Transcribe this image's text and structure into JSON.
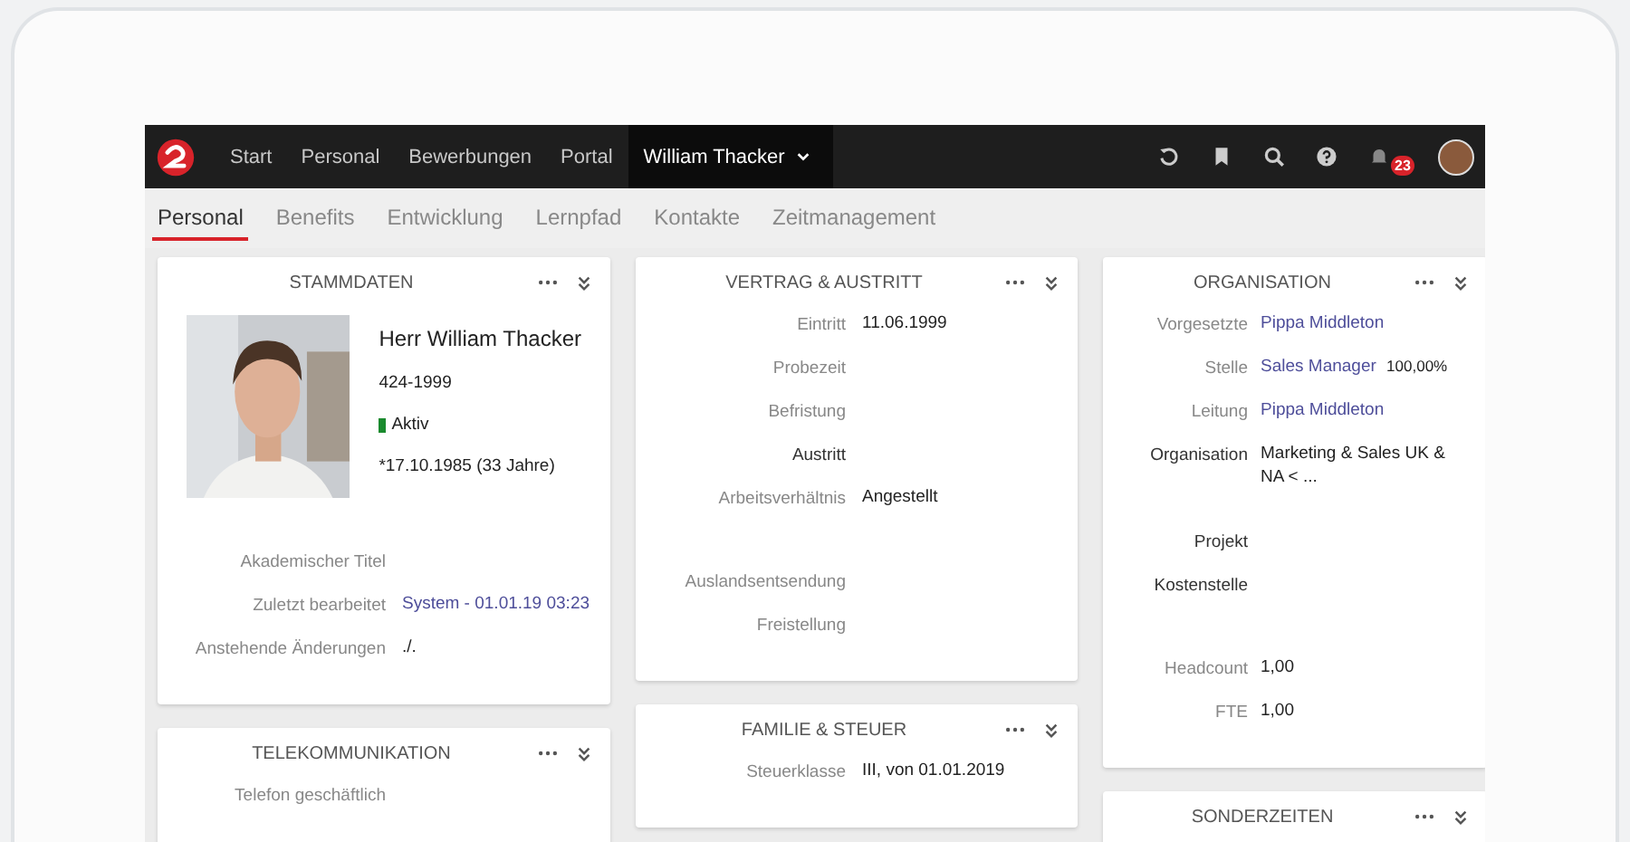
{
  "nav": {
    "items": [
      {
        "label": "Start",
        "selected": false
      },
      {
        "label": "Personal",
        "selected": false
      },
      {
        "label": "Bewerbungen",
        "selected": false
      },
      {
        "label": "Portal",
        "selected": false
      },
      {
        "label": "William Thacker",
        "selected": true
      }
    ],
    "notification_count": "23"
  },
  "tabs": [
    {
      "label": "Personal",
      "selected": true
    },
    {
      "label": "Benefits",
      "selected": false
    },
    {
      "label": "Entwicklung",
      "selected": false
    },
    {
      "label": "Lernpfad",
      "selected": false
    },
    {
      "label": "Kontakte",
      "selected": false
    },
    {
      "label": "Zeitmanagement",
      "selected": false
    }
  ],
  "columns": [
    {
      "cards": [
        {
          "title": "STAMMDATEN",
          "profile": {
            "kind": "picture",
            "name": "Herr William Thacker",
            "number": "424-1999",
            "status": "Aktiv",
            "birth": "*17.10.1985 (33 Jahre)"
          },
          "sections": [
            [
              {
                "label": "Akademischer Titel",
                "highlighted": false
              },
              {
                "label": "Zuletzt bearbeitet",
                "value": "System - 01.01.19 03:23",
                "link": true,
                "highlighted": false
              },
              {
                "label": "Anstehende Änderungen",
                "value": "./.",
                "link": false,
                "highlighted": false
              }
            ]
          ]
        },
        {
          "title": "TELEKOMMUNIKATION",
          "sections": [
            [
              {
                "label": "Telefon geschäftlich",
                "highlighted": false
              }
            ]
          ]
        }
      ]
    },
    {
      "cards": [
        {
          "title": "VERTRAG & AUSTRITT",
          "sections": [
            [
              {
                "label": "Eintritt",
                "value": "11.06.1999",
                "link": false,
                "highlighted": false
              },
              {
                "label": "Probezeit",
                "highlighted": false
              },
              {
                "label": "Befristung",
                "highlighted": false
              },
              {
                "label": "Austritt",
                "highlighted": true
              },
              {
                "label": "Arbeitsverhältnis",
                "value": "Angestellt",
                "link": false,
                "highlighted": false
              }
            ],
            [
              {
                "label": "Auslandsentsendung",
                "highlighted": false
              },
              {
                "label": "Freistellung",
                "highlighted": false
              }
            ]
          ]
        },
        {
          "title": "FAMILIE & STEUER",
          "sections": [
            [
              {
                "label": "Steuerklasse",
                "value": "III, von 01.01.2019",
                "link": false,
                "highlighted": false
              }
            ]
          ]
        }
      ]
    },
    {
      "cards": [
        {
          "title": "ORGANISATION",
          "sections": [
            [
              {
                "label": "Vorgesetzte",
                "value": "Pippa Middleton",
                "link": true,
                "highlighted": false
              },
              {
                "label": "Stelle",
                "value": "Sales Manager",
                "suffix": "100,00%",
                "link": true,
                "highlighted": false
              },
              {
                "label": "Leitung",
                "value": "Pippa Middleton",
                "link": true,
                "highlighted": false
              },
              {
                "label": "Organisation",
                "value": "Marketing & Sales UK & NA < ...",
                "link": false,
                "highlighted": true
              }
            ],
            [
              {
                "label": "Projekt",
                "highlighted": true
              },
              {
                "label": "Kostenstelle",
                "highlighted": true
              }
            ],
            [
              {
                "label": "Headcount",
                "value": "1,00",
                "link": false,
                "highlighted": false
              },
              {
                "label": "FTE",
                "value": "1,00",
                "link": false,
                "highlighted": false
              }
            ]
          ]
        },
        {
          "title": "SONDERZEITEN"
        }
      ]
    }
  ]
}
